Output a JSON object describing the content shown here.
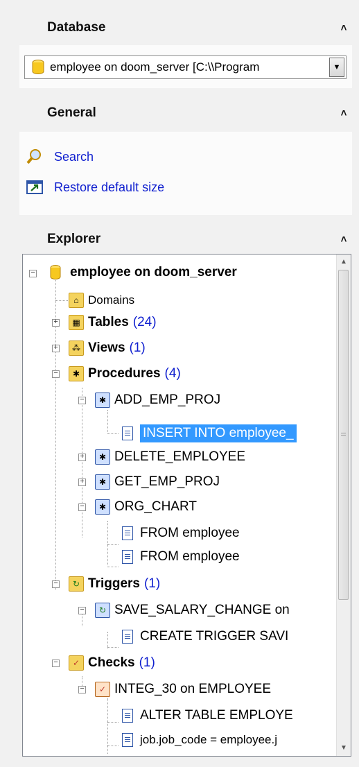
{
  "database": {
    "header": "Database",
    "collapse": "˄",
    "combo_value": "employee on doom_server [C:\\\\Program"
  },
  "general": {
    "header": "General",
    "collapse": "˄",
    "links": [
      "Search",
      "Restore default size"
    ]
  },
  "explorer": {
    "header": "Explorer",
    "collapse": "˄",
    "tree": {
      "root": "employee on doom_server",
      "domains": "Domains",
      "tables": {
        "label": "Tables",
        "count": "(24)"
      },
      "views": {
        "label": "Views",
        "count": "(1)"
      },
      "procedures": {
        "label": "Procedures",
        "count": "(4)"
      },
      "proc_items": [
        "ADD_EMP_PROJ",
        "INSERT INTO employee_",
        "DELETE_EMPLOYEE",
        "GET_EMP_PROJ",
        "ORG_CHART",
        "FROM employee",
        "FROM employee"
      ],
      "triggers": {
        "label": "Triggers",
        "count": "(1)"
      },
      "trigger_items": [
        "SAVE_SALARY_CHANGE on",
        "CREATE TRIGGER SAVI"
      ],
      "checks": {
        "label": "Checks",
        "count": "(1)"
      },
      "check_items": [
        "INTEG_30 on EMPLOYEE",
        "ALTER TABLE EMPLOYE",
        "job.job_code = employee.j"
      ]
    }
  },
  "colors": {
    "link": "#0f1fcf",
    "selection": "#3399ff",
    "folder": "#f4d35e"
  },
  "icons": [
    "database-icon",
    "search-icon",
    "restore-size-icon",
    "folder-icon",
    "document-icon"
  ]
}
